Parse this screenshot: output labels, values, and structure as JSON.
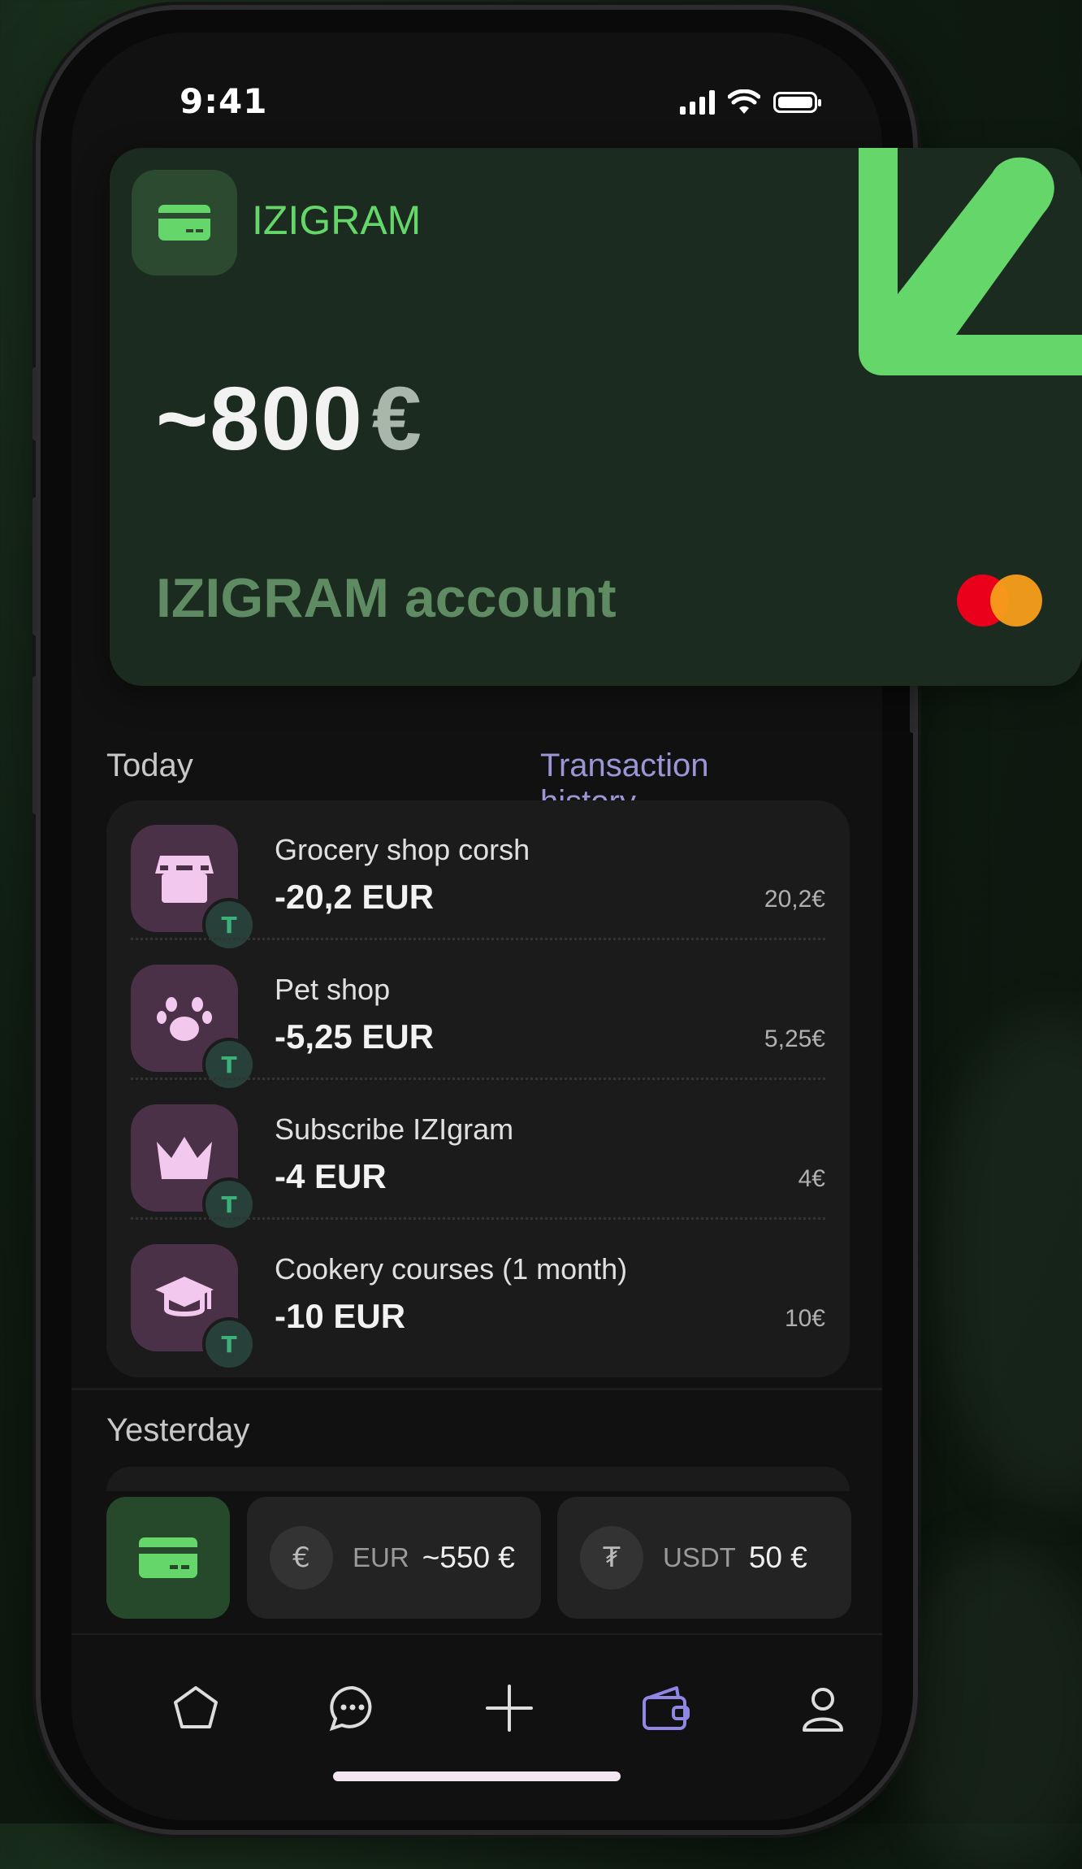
{
  "status_bar": {
    "time": "9:41"
  },
  "card": {
    "brand": "IZIGRAM",
    "amount": "~800",
    "currency_symbol": "€",
    "account_label": "IZIGRAM account",
    "accent_color": "#64d66a",
    "card_icon": "credit-card-icon",
    "network_icon": "mastercard-logo"
  },
  "today": {
    "label": "Today",
    "history_link": "Transaction history",
    "transactions": [
      {
        "icon": "storefront-icon",
        "name": "Grocery shop corsh",
        "amount": "-20,2 EUR",
        "small": "20,2€",
        "badge": "T"
      },
      {
        "icon": "paw-icon",
        "name": "Pet shop",
        "amount": "-5,25 EUR",
        "small": "5,25€",
        "badge": "T"
      },
      {
        "icon": "crown-icon",
        "name": "Subscribe IZIgram",
        "amount": "-4 EUR",
        "small": "4€",
        "badge": "T"
      },
      {
        "icon": "graduation-cap-icon",
        "name": "Cookery courses (1 month)",
        "amount": "-10 EUR",
        "small": "10€",
        "badge": "T"
      }
    ]
  },
  "yesterday": {
    "label": "Yesterday"
  },
  "accounts": [
    {
      "coin": "€",
      "currency": "EUR",
      "value": "~550 €"
    },
    {
      "coin": "₮",
      "currency": "USDT",
      "value": "50 €"
    }
  ],
  "tabbar": {
    "items": [
      "home-icon",
      "chat-icon",
      "plus-icon",
      "wallet-icon",
      "profile-icon"
    ],
    "active": "wallet-icon",
    "active_color": "#8f86e6"
  }
}
